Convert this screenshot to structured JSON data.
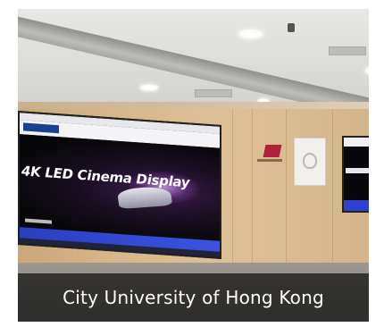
{
  "caption": {
    "text": "City University of Hong Kong"
  },
  "screen": {
    "hero_title": "4K LED Cinema Display"
  },
  "colors": {
    "caption_bg": "#1e1e1e",
    "wall": "#d7b88c",
    "screen_blue": "#2d43cf"
  }
}
